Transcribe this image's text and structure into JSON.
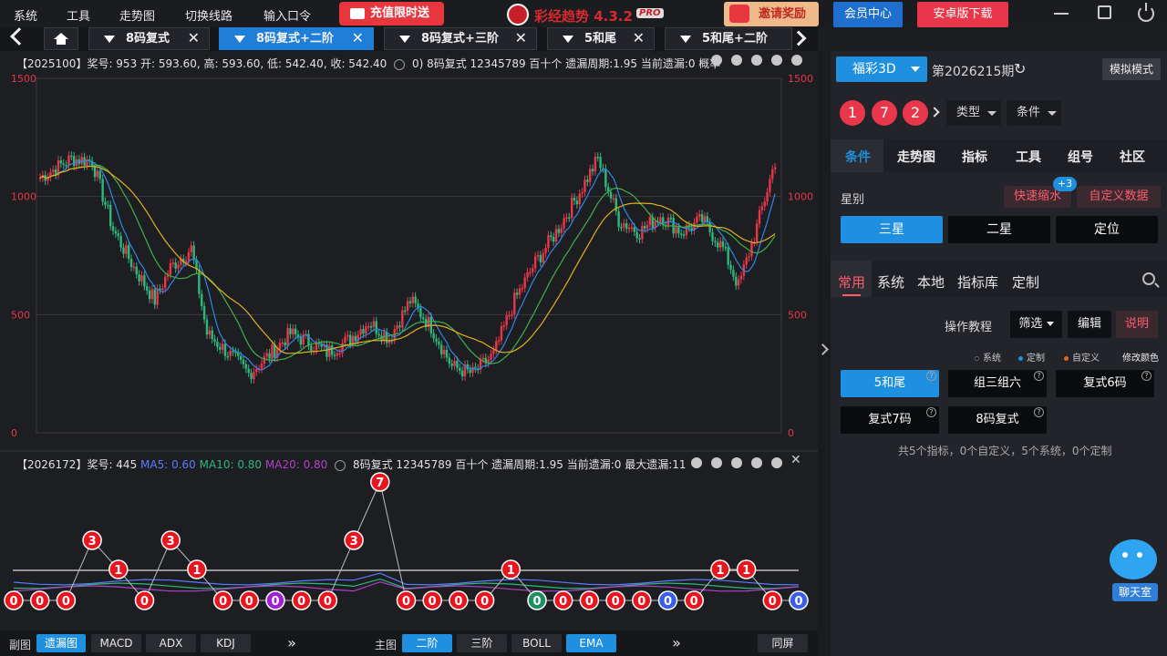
{
  "menu": {
    "items": [
      "系统",
      "工具",
      "走势图",
      "切换线路",
      "输入口令"
    ],
    "promo": "充值限时送",
    "brand": "彩经趋势 4.3.2",
    "brand_badge": "PRO",
    "invite": "邀请奖励",
    "member": "会员中心",
    "download": "安卓版下载"
  },
  "tabs": [
    {
      "label": "8码复式",
      "active": false
    },
    {
      "label": "8码复式+二阶",
      "active": true
    },
    {
      "label": "8码复式+三阶",
      "active": false
    },
    {
      "label": "5和尾",
      "active": false
    },
    {
      "label": "5和尾+二阶",
      "active": false
    }
  ],
  "main_chart": {
    "info": "【2025100】奖号: 953   开: 593.60, 高: 593.60, 低: 542.40, 收: 542.40",
    "info2": "0)   8码复式   12345789   百十个   遗漏周期:1.95   当前遗漏:0   概率",
    "y_ticks": [
      "1500",
      "1000",
      "500",
      "0"
    ],
    "ylim": [
      0,
      1500
    ],
    "colors": {
      "up": "#e8364a",
      "down": "#2db87d",
      "ma_blue": "#2f86e8",
      "ma_green": "#3fb04a",
      "ma_yellow": "#e0b020",
      "grid": "#3a3b40"
    }
  },
  "sub_chart": {
    "info_prefix": "【2026172】奖号: 445",
    "ma5": "MA5: 0.60",
    "ma10": "MA10: 0.80",
    "ma20": "MA20: 0.80",
    "info_suffix": "8码复式   12345789   百十个   遗漏周期:1.95   当前遗漏:0   最大遗漏:11",
    "points": [
      0,
      0,
      0,
      3,
      1,
      0,
      3,
      1,
      0,
      0,
      0,
      0,
      0,
      3,
      7,
      0,
      0,
      0,
      0,
      1,
      0,
      0,
      0,
      0,
      0,
      0,
      0,
      1,
      1,
      0,
      0
    ],
    "peaks": [
      {
        "v": "3",
        "i": 3
      },
      {
        "v": "1",
        "i": 4
      },
      {
        "v": "3",
        "i": 6
      },
      {
        "v": "1",
        "i": 7
      },
      {
        "v": "3",
        "i": 13
      },
      {
        "v": "7",
        "i": 14
      },
      {
        "v": "1",
        "i": 19
      },
      {
        "v": "1",
        "i": 27
      },
      {
        "v": "1",
        "i": 28
      }
    ],
    "zeros": [
      {
        "v": "0",
        "i": 0,
        "c": "red"
      },
      {
        "v": "0",
        "i": 1,
        "c": "red"
      },
      {
        "v": "0",
        "i": 2,
        "c": "red"
      },
      {
        "v": "0",
        "i": 5,
        "c": "red"
      },
      {
        "v": "0",
        "i": 8,
        "c": "red"
      },
      {
        "v": "0",
        "i": 9,
        "c": "red"
      },
      {
        "v": "0",
        "i": 10,
        "c": "purple"
      },
      {
        "v": "0",
        "i": 11,
        "c": "red"
      },
      {
        "v": "0",
        "i": 12,
        "c": "red"
      },
      {
        "v": "0",
        "i": 15,
        "c": "red"
      },
      {
        "v": "0",
        "i": 16,
        "c": "red"
      },
      {
        "v": "0",
        "i": 17,
        "c": "red"
      },
      {
        "v": "0",
        "i": 18,
        "c": "red"
      },
      {
        "v": "0",
        "i": 20,
        "c": "green"
      },
      {
        "v": "0",
        "i": 21,
        "c": "red"
      },
      {
        "v": "0",
        "i": 22,
        "c": "red"
      },
      {
        "v": "0",
        "i": 23,
        "c": "red"
      },
      {
        "v": "0",
        "i": 24,
        "c": "red"
      },
      {
        "v": "0",
        "i": 25,
        "c": "blue"
      },
      {
        "v": "0",
        "i": 26,
        "c": "red"
      },
      {
        "v": "0",
        "i": 29,
        "c": "red"
      },
      {
        "v": "0",
        "i": 30,
        "c": "blue"
      }
    ]
  },
  "bottom": {
    "sub_label": "副图",
    "sub_btns": [
      "遗漏图",
      "MACD",
      "ADX",
      "KDJ"
    ],
    "more": "»",
    "main_label": "主图",
    "main_btns": [
      "二阶",
      "三阶",
      "BOLL",
      "EMA"
    ],
    "sync": "同屏"
  },
  "panel": {
    "lottery": "福彩3D",
    "period": "第2026215期",
    "sim": "模拟模式",
    "balls": [
      "1",
      "7",
      "2"
    ],
    "type_label": "类型",
    "cond_label": "条件",
    "tabs": [
      "条件",
      "走势图",
      "指标",
      "工具",
      "组号",
      "社区"
    ],
    "star_label": "星别",
    "quick": "快速缩水",
    "badge": "+3",
    "custom_data": "自定义数据",
    "stars": [
      "三星",
      "二星",
      "定位"
    ],
    "subtabs": [
      "常用",
      "系统",
      "本地",
      "指标库",
      "定制"
    ],
    "tutorial": "操作教程",
    "filter": "筛选",
    "edit": "编辑",
    "explain": "说明",
    "legend": [
      "系统",
      "定制",
      "自定义",
      "修改颜色"
    ],
    "indicators": [
      "5和尾",
      "组三组六",
      "复式6码",
      "复式7码",
      "8码复式"
    ],
    "summary": "共5个指标，0个自定义，5个系统，0个定制",
    "chat": "聊天室"
  }
}
